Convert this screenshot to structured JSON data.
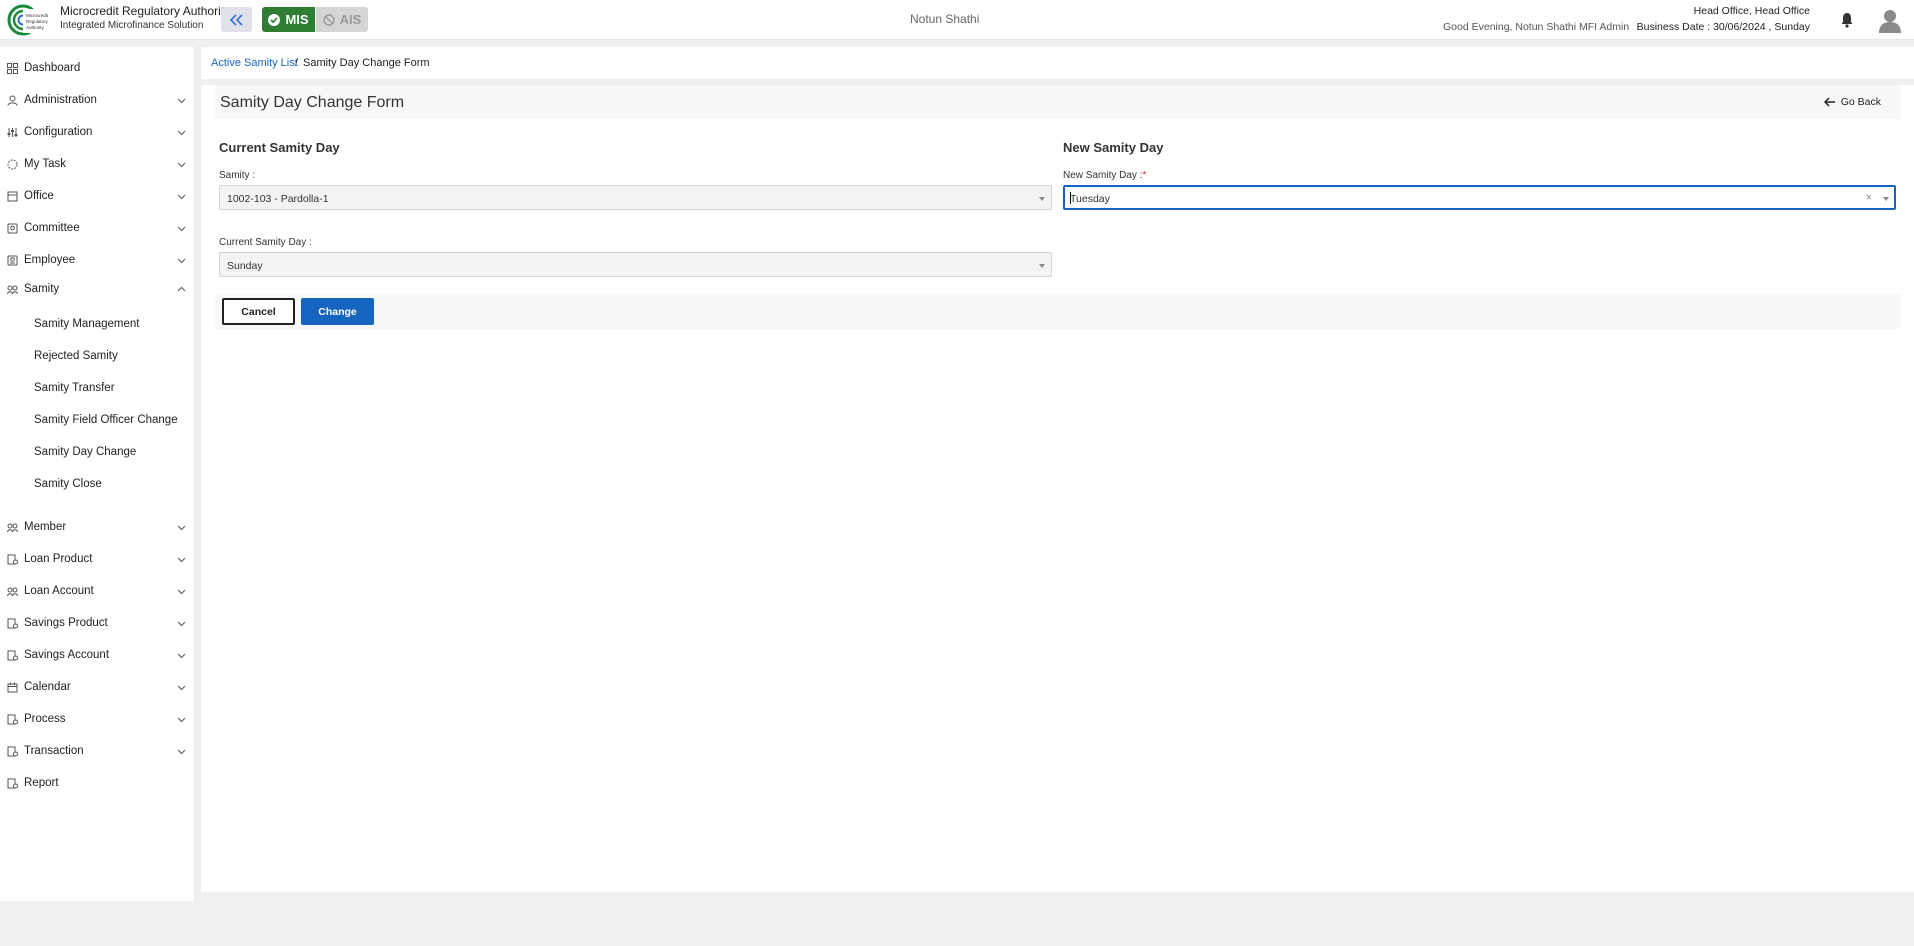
{
  "header": {
    "brand_title": "Microcredit Regulatory Authority",
    "brand_sub": "Integrated Microfinance Solution",
    "mis_label": "MIS",
    "ais_label": "AIS",
    "org_name": "Notun Shathi",
    "greeting": "Good Evening, Notun Shathi MFI Admin",
    "office": "Head Office, Head Office",
    "business_date": "Business Date : 30/06/2024 , Sunday"
  },
  "sidebar": {
    "items": [
      {
        "label": "Dashboard",
        "icon": "dashboard-icon"
      },
      {
        "label": "Administration",
        "icon": "admin-icon"
      },
      {
        "label": "Configuration",
        "icon": "config-icon"
      },
      {
        "label": "My Task",
        "icon": "task-icon"
      },
      {
        "label": "Office",
        "icon": "office-icon"
      },
      {
        "label": "Committee",
        "icon": "committee-icon"
      },
      {
        "label": "Employee",
        "icon": "employee-icon"
      },
      {
        "label": "Samity",
        "icon": "samity-icon"
      },
      {
        "label": "Member",
        "icon": "member-icon"
      },
      {
        "label": "Loan Product",
        "icon": "loan-product-icon"
      },
      {
        "label": "Loan Account",
        "icon": "loan-account-icon"
      },
      {
        "label": "Savings Product",
        "icon": "savings-product-icon"
      },
      {
        "label": "Savings Account",
        "icon": "savings-account-icon"
      },
      {
        "label": "Calendar",
        "icon": "calendar-icon"
      },
      {
        "label": "Process",
        "icon": "process-icon"
      },
      {
        "label": "Transaction",
        "icon": "transaction-icon"
      },
      {
        "label": "Report",
        "icon": "report-icon"
      }
    ],
    "samity_sub": [
      "Samity Management",
      "Rejected Samity",
      "Samity Transfer",
      "Samity Field Officer Change",
      "Samity Day Change",
      "Samity Close"
    ]
  },
  "breadcrumb": {
    "link": "Active Samity List",
    "separator": "/",
    "current": "Samity Day Change Form"
  },
  "form": {
    "title": "Samity Day Change Form",
    "go_back": "Go Back",
    "current_section": "Current Samity Day",
    "new_section": "New Samity Day",
    "samity_label": "Samity :",
    "samity_value": "1002-103 - Pardolla-1",
    "current_day_label": "Current Samity Day :",
    "current_day_value": "Sunday",
    "new_day_label": "New Samity Day :",
    "new_day_required": "*",
    "new_day_value": "Tuesday",
    "cancel_label": "Cancel",
    "change_label": "Change"
  },
  "colors": {
    "primary": "#1565c0",
    "mis_green": "#2e7d32",
    "required": "#d32f2f"
  }
}
